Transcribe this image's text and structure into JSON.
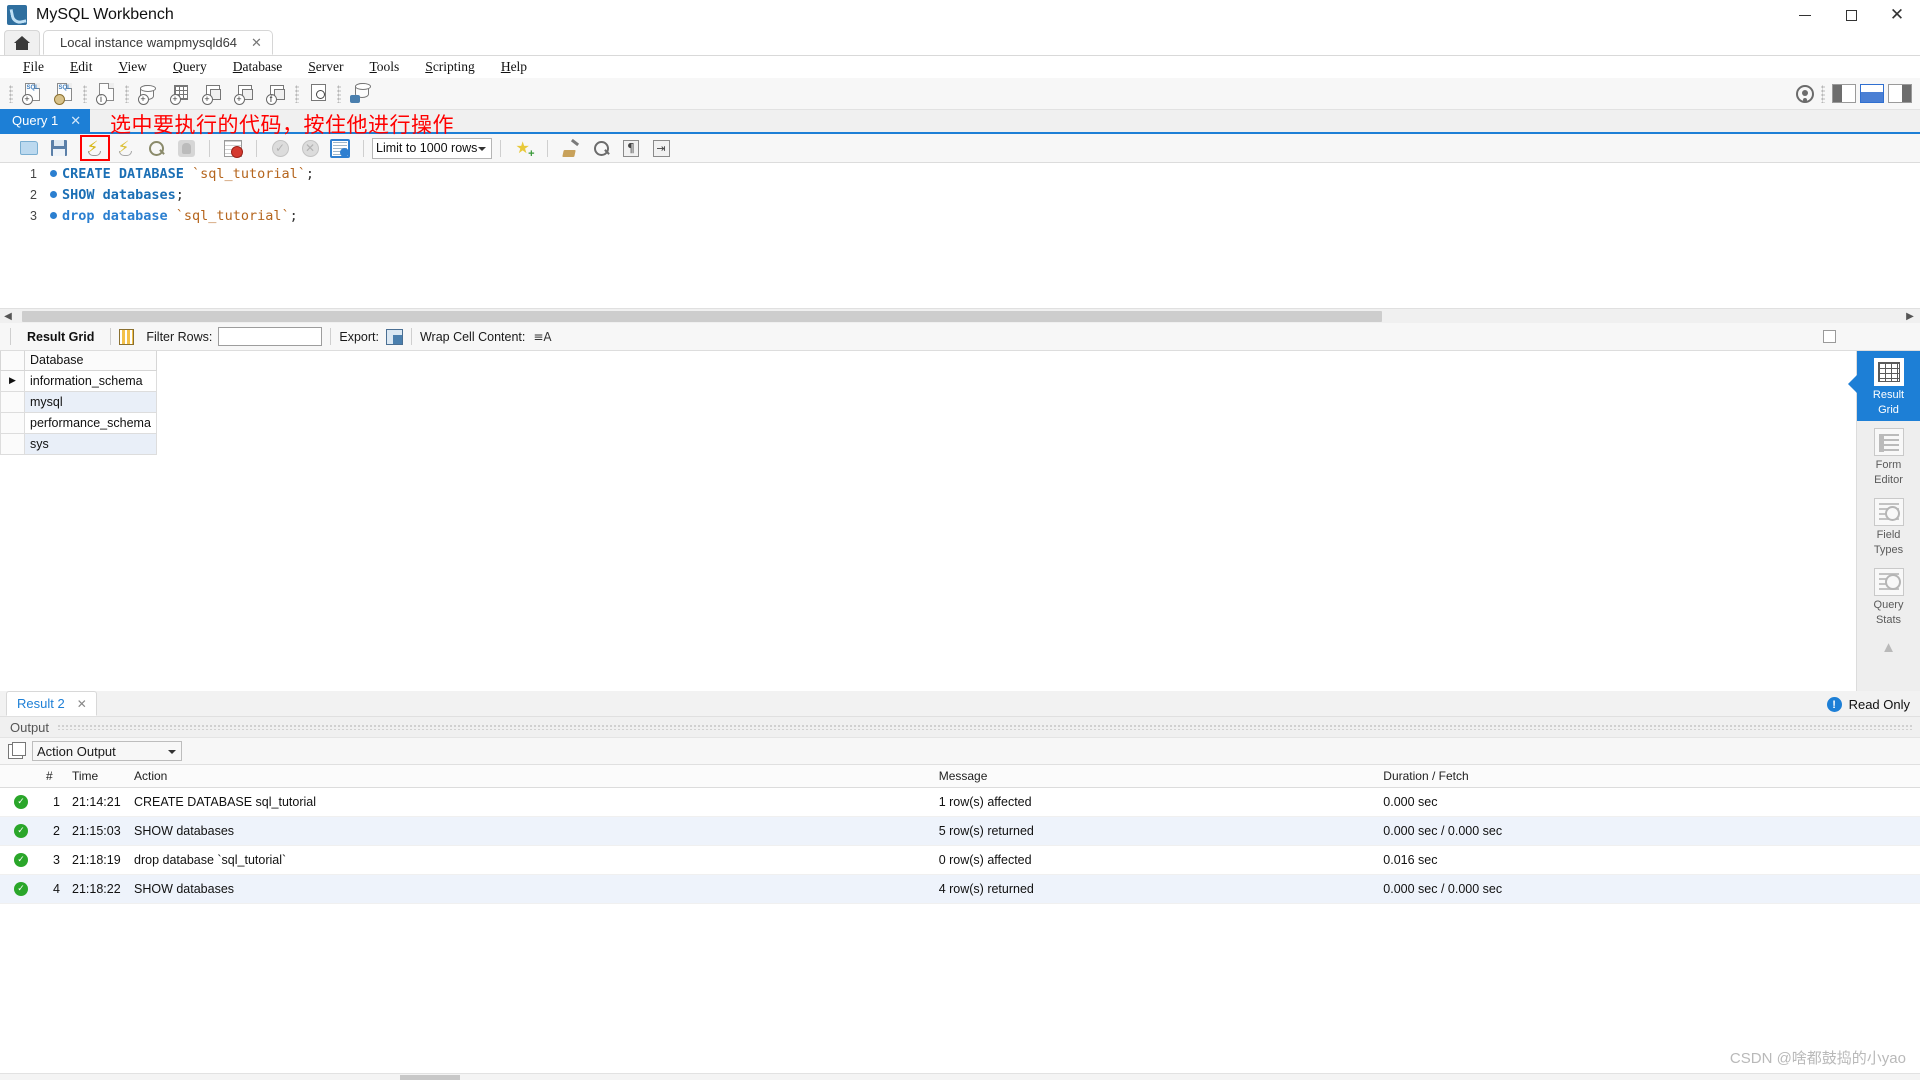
{
  "window": {
    "title": "MySQL Workbench",
    "minimize_label": "—",
    "maximize_label": "☐",
    "close_label": "✕"
  },
  "tabs": {
    "home_icon": "home-icon",
    "connection_tab": "Local instance wampmysqld64",
    "close_label": "✕"
  },
  "menubar": [
    {
      "label": "File"
    },
    {
      "label": "Edit"
    },
    {
      "label": "View"
    },
    {
      "label": "Query"
    },
    {
      "label": "Database"
    },
    {
      "label": "Server"
    },
    {
      "label": "Tools"
    },
    {
      "label": "Scripting"
    },
    {
      "label": "Help"
    }
  ],
  "main_toolbar": {
    "icons": [
      "new-sql-tab-icon",
      "open-sql-script-icon",
      "connection-info-icon",
      "new-schema-icon",
      "new-table-icon",
      "new-view-icon",
      "new-procedure-icon",
      "new-function-icon",
      "inspector-icon",
      "reconnect-icon"
    ],
    "account_icon": "account-icon",
    "panel_buttons": [
      "sidebar-toggle",
      "output-toggle",
      "secondary-sidebar-toggle"
    ]
  },
  "query_tab": {
    "label": "Query 1",
    "close_label": "✕",
    "annotation": "选中要执行的代码，按住他进行操作",
    "annotation_color": "#ff0000"
  },
  "sql_toolbar": {
    "icons": [
      "open-file-icon",
      "save-file-icon",
      "execute-icon",
      "execute-current-statement-icon",
      "explain-icon",
      "stop-execution-icon",
      "toggle-stop-on-error-icon",
      "commit-icon",
      "rollback-icon",
      "toggle-autocommit-icon",
      "add-snippet-icon",
      "beautify-sql-icon",
      "find-icon",
      "toggle-invisible-chars-icon",
      "toggle-wrapping-icon"
    ],
    "limit_select": "Limit to 1000 rows",
    "execute_highlighted": true
  },
  "editor": {
    "lines": [
      {
        "number": "1",
        "segments": [
          {
            "text": "CREATE DATABASE ",
            "type": "keyword"
          },
          {
            "text": "`sql_tutorial`",
            "type": "ident"
          },
          {
            "text": ";",
            "type": "punc"
          }
        ]
      },
      {
        "number": "2",
        "segments": [
          {
            "text": "SHOW databases",
            "type": "keyword"
          },
          {
            "text": ";",
            "type": "punc"
          }
        ]
      },
      {
        "number": "3",
        "segments": [
          {
            "text": "drop database ",
            "type": "keyword"
          },
          {
            "text": "`sql_tutorial`",
            "type": "ident"
          },
          {
            "text": ";",
            "type": "punc"
          }
        ]
      }
    ],
    "line1_text": "CREATE DATABASE `sql_tutorial`;",
    "line2_text": "SHOW databases;",
    "line3_text": "drop database `sql_tutorial`;"
  },
  "result_toolbar": {
    "result_grid_label": "Result Grid",
    "grid_icon": "grid-stripes-icon",
    "filter_label": "Filter Rows:",
    "filter_value": "",
    "export_label": "Export:",
    "export_icon": "export-icon",
    "wrap_label": "Wrap Cell Content:",
    "wrap_icon": "wrap-text-icon"
  },
  "result_grid": {
    "columns": [
      "Database"
    ],
    "rows": [
      {
        "selected": true,
        "Database": "information_schema"
      },
      {
        "selected": false,
        "Database": "mysql"
      },
      {
        "selected": false,
        "Database": "performance_schema"
      },
      {
        "selected": false,
        "Database": "sys"
      }
    ]
  },
  "right_sidebar": {
    "items": [
      {
        "label_line1": "Result",
        "label_line2": "Grid",
        "icon": "result-grid-icon",
        "active": true
      },
      {
        "label_line1": "Form",
        "label_line2": "Editor",
        "icon": "form-editor-icon",
        "active": false
      },
      {
        "label_line1": "Field",
        "label_line2": "Types",
        "icon": "field-types-icon",
        "active": false
      },
      {
        "label_line1": "Query",
        "label_line2": "Stats",
        "icon": "query-stats-icon",
        "active": false
      }
    ],
    "collapse_icon": "chevron-up-icon"
  },
  "result_tab": {
    "label": "Result 2",
    "close_label": "✕",
    "read_only": "Read Only",
    "info_icon": "info-icon"
  },
  "output": {
    "panel_title": "Output",
    "copy_icon": "copy-icon",
    "selected_view": "Action Output",
    "columns": [
      "#",
      "Time",
      "Action",
      "Message",
      "Duration / Fetch"
    ],
    "rows": [
      {
        "status": "success",
        "num": "1",
        "time": "21:14:21",
        "action": "CREATE DATABASE sql_tutorial",
        "message": "1 row(s) affected",
        "duration": "0.000 sec"
      },
      {
        "status": "success",
        "num": "2",
        "time": "21:15:03",
        "action": "SHOW databases",
        "message": "5 row(s) returned",
        "duration": "0.000 sec / 0.000 sec"
      },
      {
        "status": "success",
        "num": "3",
        "time": "21:18:19",
        "action": "drop database `sql_tutorial`",
        "message": "0 row(s) affected",
        "duration": "0.016 sec"
      },
      {
        "status": "success",
        "num": "4",
        "time": "21:18:22",
        "action": "SHOW databases",
        "message": "4 row(s) returned",
        "duration": "0.000 sec / 0.000 sec"
      }
    ]
  },
  "watermark": "CSDN @啥都鼓捣的小yao",
  "colors": {
    "accent": "#1d7fd6",
    "annotation": "#ff0000",
    "success": "#2aa62a",
    "alt_row": "#eef3fb"
  }
}
